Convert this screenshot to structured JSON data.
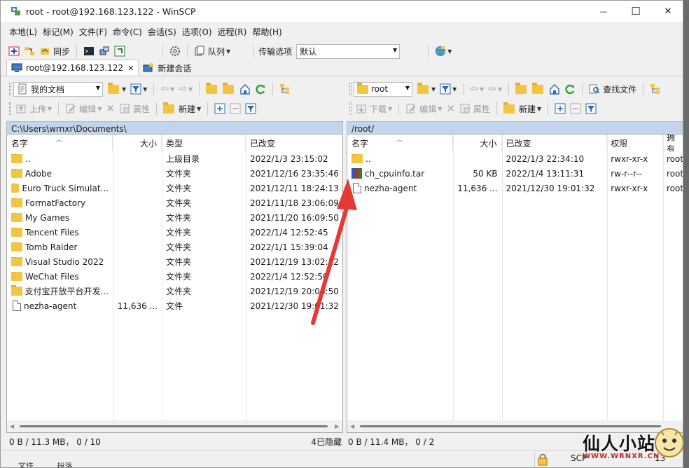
{
  "window": {
    "title": "root - root@192.168.123.122 - WinSCP",
    "minimize_glyph": "—",
    "maximize_glyph": "☐",
    "close_glyph": "✕"
  },
  "menu": [
    "本地(L)",
    "标记(M)",
    "文件(F)",
    "命令(C)",
    "会话(S)",
    "选项(O)",
    "远程(R)",
    "帮助(H)"
  ],
  "toolbar": {
    "sync_label": "同步",
    "queue_label": "队列",
    "transfer_label": "传输选项",
    "transfer_value": "默认"
  },
  "tabs": {
    "session_label": "root@192.168.123.122",
    "close_glyph": "✕",
    "new_session_label": "新建会话"
  },
  "left": {
    "location": "我的文档",
    "upload_label": "上传",
    "edit_label": "编辑",
    "properties_label": "属性",
    "new_label": "新建",
    "path": "C:\\Users\\wrnxr\\Documents\\",
    "columns": {
      "name": "名字",
      "size": "大小",
      "type": "类型",
      "changed": "已改变"
    },
    "rows": [
      {
        "name": "..",
        "size": "",
        "type": "上级目录",
        "changed": "2022/1/3   23:15:02",
        "icon": "parent-folder"
      },
      {
        "name": "Adobe",
        "size": "",
        "type": "文件夹",
        "changed": "2021/12/16   23:35:46",
        "icon": "folder"
      },
      {
        "name": "Euro Truck Simulat...",
        "size": "",
        "type": "文件夹",
        "changed": "2021/12/11   18:24:13",
        "icon": "folder"
      },
      {
        "name": "FormatFactory",
        "size": "",
        "type": "文件夹",
        "changed": "2021/11/18   23:06:09",
        "icon": "folder"
      },
      {
        "name": "My Games",
        "size": "",
        "type": "文件夹",
        "changed": "2021/11/20   16:09:50",
        "icon": "folder"
      },
      {
        "name": "Tencent Files",
        "size": "",
        "type": "文件夹",
        "changed": "2022/1/4   12:52:45",
        "icon": "folder"
      },
      {
        "name": "Tomb Raider",
        "size": "",
        "type": "文件夹",
        "changed": "2022/1/1   15:39:04",
        "icon": "folder"
      },
      {
        "name": "Visual Studio 2022",
        "size": "",
        "type": "文件夹",
        "changed": "2021/12/19   13:02:12",
        "icon": "folder"
      },
      {
        "name": "WeChat Files",
        "size": "",
        "type": "文件夹",
        "changed": "2022/1/4   12:52:50",
        "icon": "folder"
      },
      {
        "name": "支付宝开放平台开发...",
        "size": "",
        "type": "文件夹",
        "changed": "2021/12/19   20:06:50",
        "icon": "folder"
      },
      {
        "name": "nezha-agent",
        "size": "11,636 ...",
        "type": "文件",
        "changed": "2021/12/30   19:01:32",
        "icon": "file"
      }
    ],
    "status_left": "0 B / 11.3 MB，  0 / 10",
    "status_right": "4已隐藏"
  },
  "right": {
    "location": "root",
    "download_label": "下载",
    "edit_label": "编辑",
    "properties_label": "属性",
    "new_label": "新建",
    "find_label": "查找文件",
    "path": "/root/",
    "columns": {
      "name": "名字",
      "size": "大小",
      "changed": "已改变",
      "rights": "权限",
      "owner": "拥有"
    },
    "rows": [
      {
        "name": "..",
        "size": "",
        "changed": "2022/1/3 22:34:10",
        "rights": "rwxr-xr-x",
        "owner": "root",
        "icon": "parent-folder"
      },
      {
        "name": "ch_cpuinfo.tar",
        "size": "50 KB",
        "changed": "2022/1/4 13:11:31",
        "rights": "rw-r--r--",
        "owner": "root",
        "icon": "archive"
      },
      {
        "name": "nezha-agent",
        "size": "11,636 ...",
        "changed": "2021/12/30 19:01:32",
        "rights": "rwxr-xr-x",
        "owner": "root",
        "icon": "file"
      }
    ],
    "status_left": "0 B / 11.4 MB，  0 / 2"
  },
  "statusbar": {
    "protocol": "SCP",
    "time_fragment": "13",
    "lock_icon": "lock-icon"
  },
  "bottom_fragment": {
    "text1": "文件",
    "text2": "段落"
  },
  "watermark": {
    "title": "仙人小站",
    "url": "WWW.WRNXR.CN"
  },
  "colors": {
    "path_bar": "#c3d5ea",
    "arrow": "#e53935",
    "folder": "#f4c542"
  }
}
